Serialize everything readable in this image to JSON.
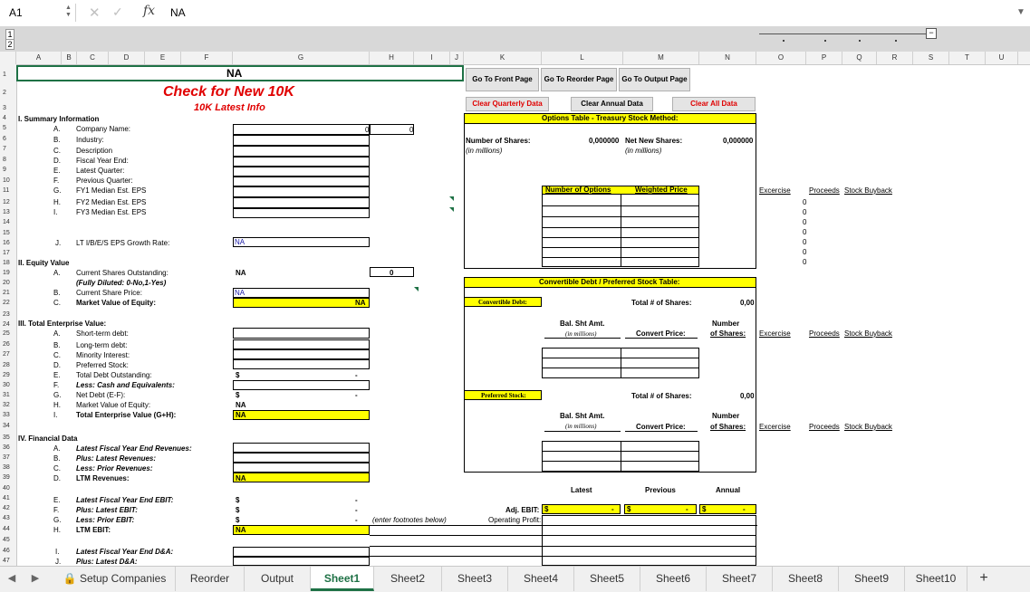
{
  "formula_bar": {
    "cell_ref": "A1",
    "fx_label": "fx",
    "value": "NA"
  },
  "outline": {
    "level1": "1",
    "level2": "2"
  },
  "columns": [
    "A",
    "B",
    "C",
    "D",
    "E",
    "F",
    "G",
    "H",
    "I",
    "J",
    "K",
    "L",
    "M",
    "N",
    "O",
    "P",
    "Q",
    "R",
    "S",
    "T",
    "U"
  ],
  "rows": [
    "1",
    "2",
    "3",
    "4",
    "5",
    "6",
    "7",
    "8",
    "9",
    "10",
    "11",
    "12",
    "13",
    "14",
    "15",
    "16",
    "17",
    "18",
    "19",
    "20",
    "21",
    "22",
    "23",
    "24",
    "25",
    "26",
    "27",
    "28",
    "29",
    "30",
    "31",
    "32",
    "33",
    "34",
    "35",
    "36",
    "37",
    "38",
    "39",
    "40",
    "41",
    "42",
    "43",
    "44",
    "45",
    "46",
    "47"
  ],
  "header": {
    "title_cell": "NA",
    "check_title": "Check for New 10K",
    "subtitle": "10K Latest Info"
  },
  "buttons": {
    "front": "Go To Front Page",
    "reorder": "Go To Reorder Page",
    "output": "Go To Output Page",
    "clear_quarterly": "Clear Quarterly Data",
    "clear_annual": "Clear Annual Data",
    "clear_all": "Clear All Data"
  },
  "summary": {
    "heading": "I. Summary Information",
    "items": [
      {
        "letter": "A.",
        "label": "Company Name:"
      },
      {
        "letter": "B.",
        "label": "Industry:"
      },
      {
        "letter": "C.",
        "label": "Description"
      },
      {
        "letter": "D.",
        "label": "Fiscal Year End:"
      },
      {
        "letter": "E.",
        "label": "Latest Quarter:"
      },
      {
        "letter": "F.",
        "label": "Previous Quarter:"
      },
      {
        "letter": "G.",
        "label": "FY1 Median Est. EPS"
      },
      {
        "letter": "H.",
        "label": "FY2 Median Est. EPS"
      },
      {
        "letter": "I.",
        "label": "FY3 Median Est. EPS"
      }
    ],
    "company_value": "0",
    "company_value2": "0",
    "growth_letter": "J.",
    "growth_label": "LT I/B/E/S EPS Growth Rate:",
    "growth_value": "NA"
  },
  "equity": {
    "heading": "II. Equity Value",
    "a_letter": "A.",
    "a_label": "Current Shares Outstanding:",
    "a_value": "NA",
    "a_value2": "0",
    "a_note": "(Fully Diluted: 0-No,1-Yes)",
    "b_letter": "B.",
    "b_label": "Current Share Price:",
    "b_value": "NA",
    "c_letter": "C.",
    "c_label": "Market Value of Equity:",
    "c_value": "NA"
  },
  "tev": {
    "heading": "III. Total Enterprise Value:",
    "items": [
      {
        "letter": "A.",
        "label": "Short-term debt:"
      },
      {
        "letter": "B.",
        "label": "Long-term debt:"
      },
      {
        "letter": "C.",
        "label": "Minority Interest:"
      },
      {
        "letter": "D.",
        "label": "Preferred Stock:"
      },
      {
        "letter": "E.",
        "label": "Total Debt Outstanding:"
      },
      {
        "letter": "F.",
        "label": "Less: Cash and Equivalents:"
      },
      {
        "letter": "G.",
        "label": "Net Debt (E-F):"
      },
      {
        "letter": "H.",
        "label": "Market Value of Equity:"
      },
      {
        "letter": "I.",
        "label": "Total Enterprise Value (G+H):"
      }
    ],
    "e_value": "$",
    "e_dash": "-",
    "g_value": "$",
    "g_dash": "-",
    "h_value": "NA",
    "i_value": "NA"
  },
  "financial": {
    "heading": "IV. Financial Data",
    "items": [
      {
        "letter": "A.",
        "label": "Latest Fiscal Year End Revenues:"
      },
      {
        "letter": "B.",
        "label": "Plus: Latest  Revenues:"
      },
      {
        "letter": "C.",
        "label": "Less: Prior  Revenues:"
      },
      {
        "letter": "D.",
        "label": "LTM Revenues:"
      },
      {
        "letter": "E.",
        "label": "Latest Fiscal Year End EBIT:"
      },
      {
        "letter": "F.",
        "label": "Plus: Latest  EBIT:"
      },
      {
        "letter": "G.",
        "label": "Less: Prior  EBIT:"
      },
      {
        "letter": "H.",
        "label": "LTM EBIT:"
      },
      {
        "letter": "I.",
        "label": "Latest Fiscal Year End D&A:"
      },
      {
        "letter": "J.",
        "label": "Plus: Latest  D&A:"
      }
    ],
    "d_value": "NA",
    "h_value": "NA",
    "dollar": "$",
    "dash": "-",
    "footnote": "(enter footnotes below)"
  },
  "options": {
    "title": "Options Table - Treasury Stock Method:",
    "shares_label": "Number of Shares:",
    "shares_unit": "(in millions)",
    "shares_value": "0,000000",
    "net_label": "Net New Shares:",
    "net_unit": "(in millions)",
    "net_value": "0,000000",
    "col1": "Number of Options",
    "col2": "Weighted Price"
  },
  "side_headers": {
    "exercise": "Excercise",
    "proceeds": "Proceeds",
    "buyback": "Stock Buyback"
  },
  "zeros": [
    "0",
    "0",
    "0",
    "0",
    "0",
    "0",
    "0"
  ],
  "convertible": {
    "title": "Convertible Debt / Preferred Stock Table:",
    "debt_tag": "Convertible Debt:",
    "total_label": "Total # of Shares:",
    "total_value": "0,00",
    "bal_label": "Bal. Sht Amt.",
    "bal_unit": "(in millions)",
    "conv_label": "Convert Price:",
    "num_label": "Number",
    "num_label2": "of Shares:",
    "pref_tag": "Preferred Stock:",
    "pref_total_label": "Total # of Shares:",
    "pref_total_value": "0,00"
  },
  "ebit_block": {
    "latest": "Latest",
    "previous": "Previous",
    "annual": "Annual",
    "adj_label": "Adj. EBIT:",
    "op_label": "Operating Profit:",
    "dollar": "$",
    "dash": "-"
  },
  "tabs": [
    "Setup Companies",
    "Reorder",
    "Output",
    "Sheet1",
    "Sheet2",
    "Sheet3",
    "Sheet4",
    "Sheet5",
    "Sheet6",
    "Sheet7",
    "Sheet8",
    "Sheet9",
    "Sheet10"
  ],
  "active_tab": "Sheet1",
  "add_sheet": "+",
  "colors": {
    "accent_green": "#1e7145",
    "highlight_yellow": "#ffff00",
    "title_red": "#e00000"
  }
}
